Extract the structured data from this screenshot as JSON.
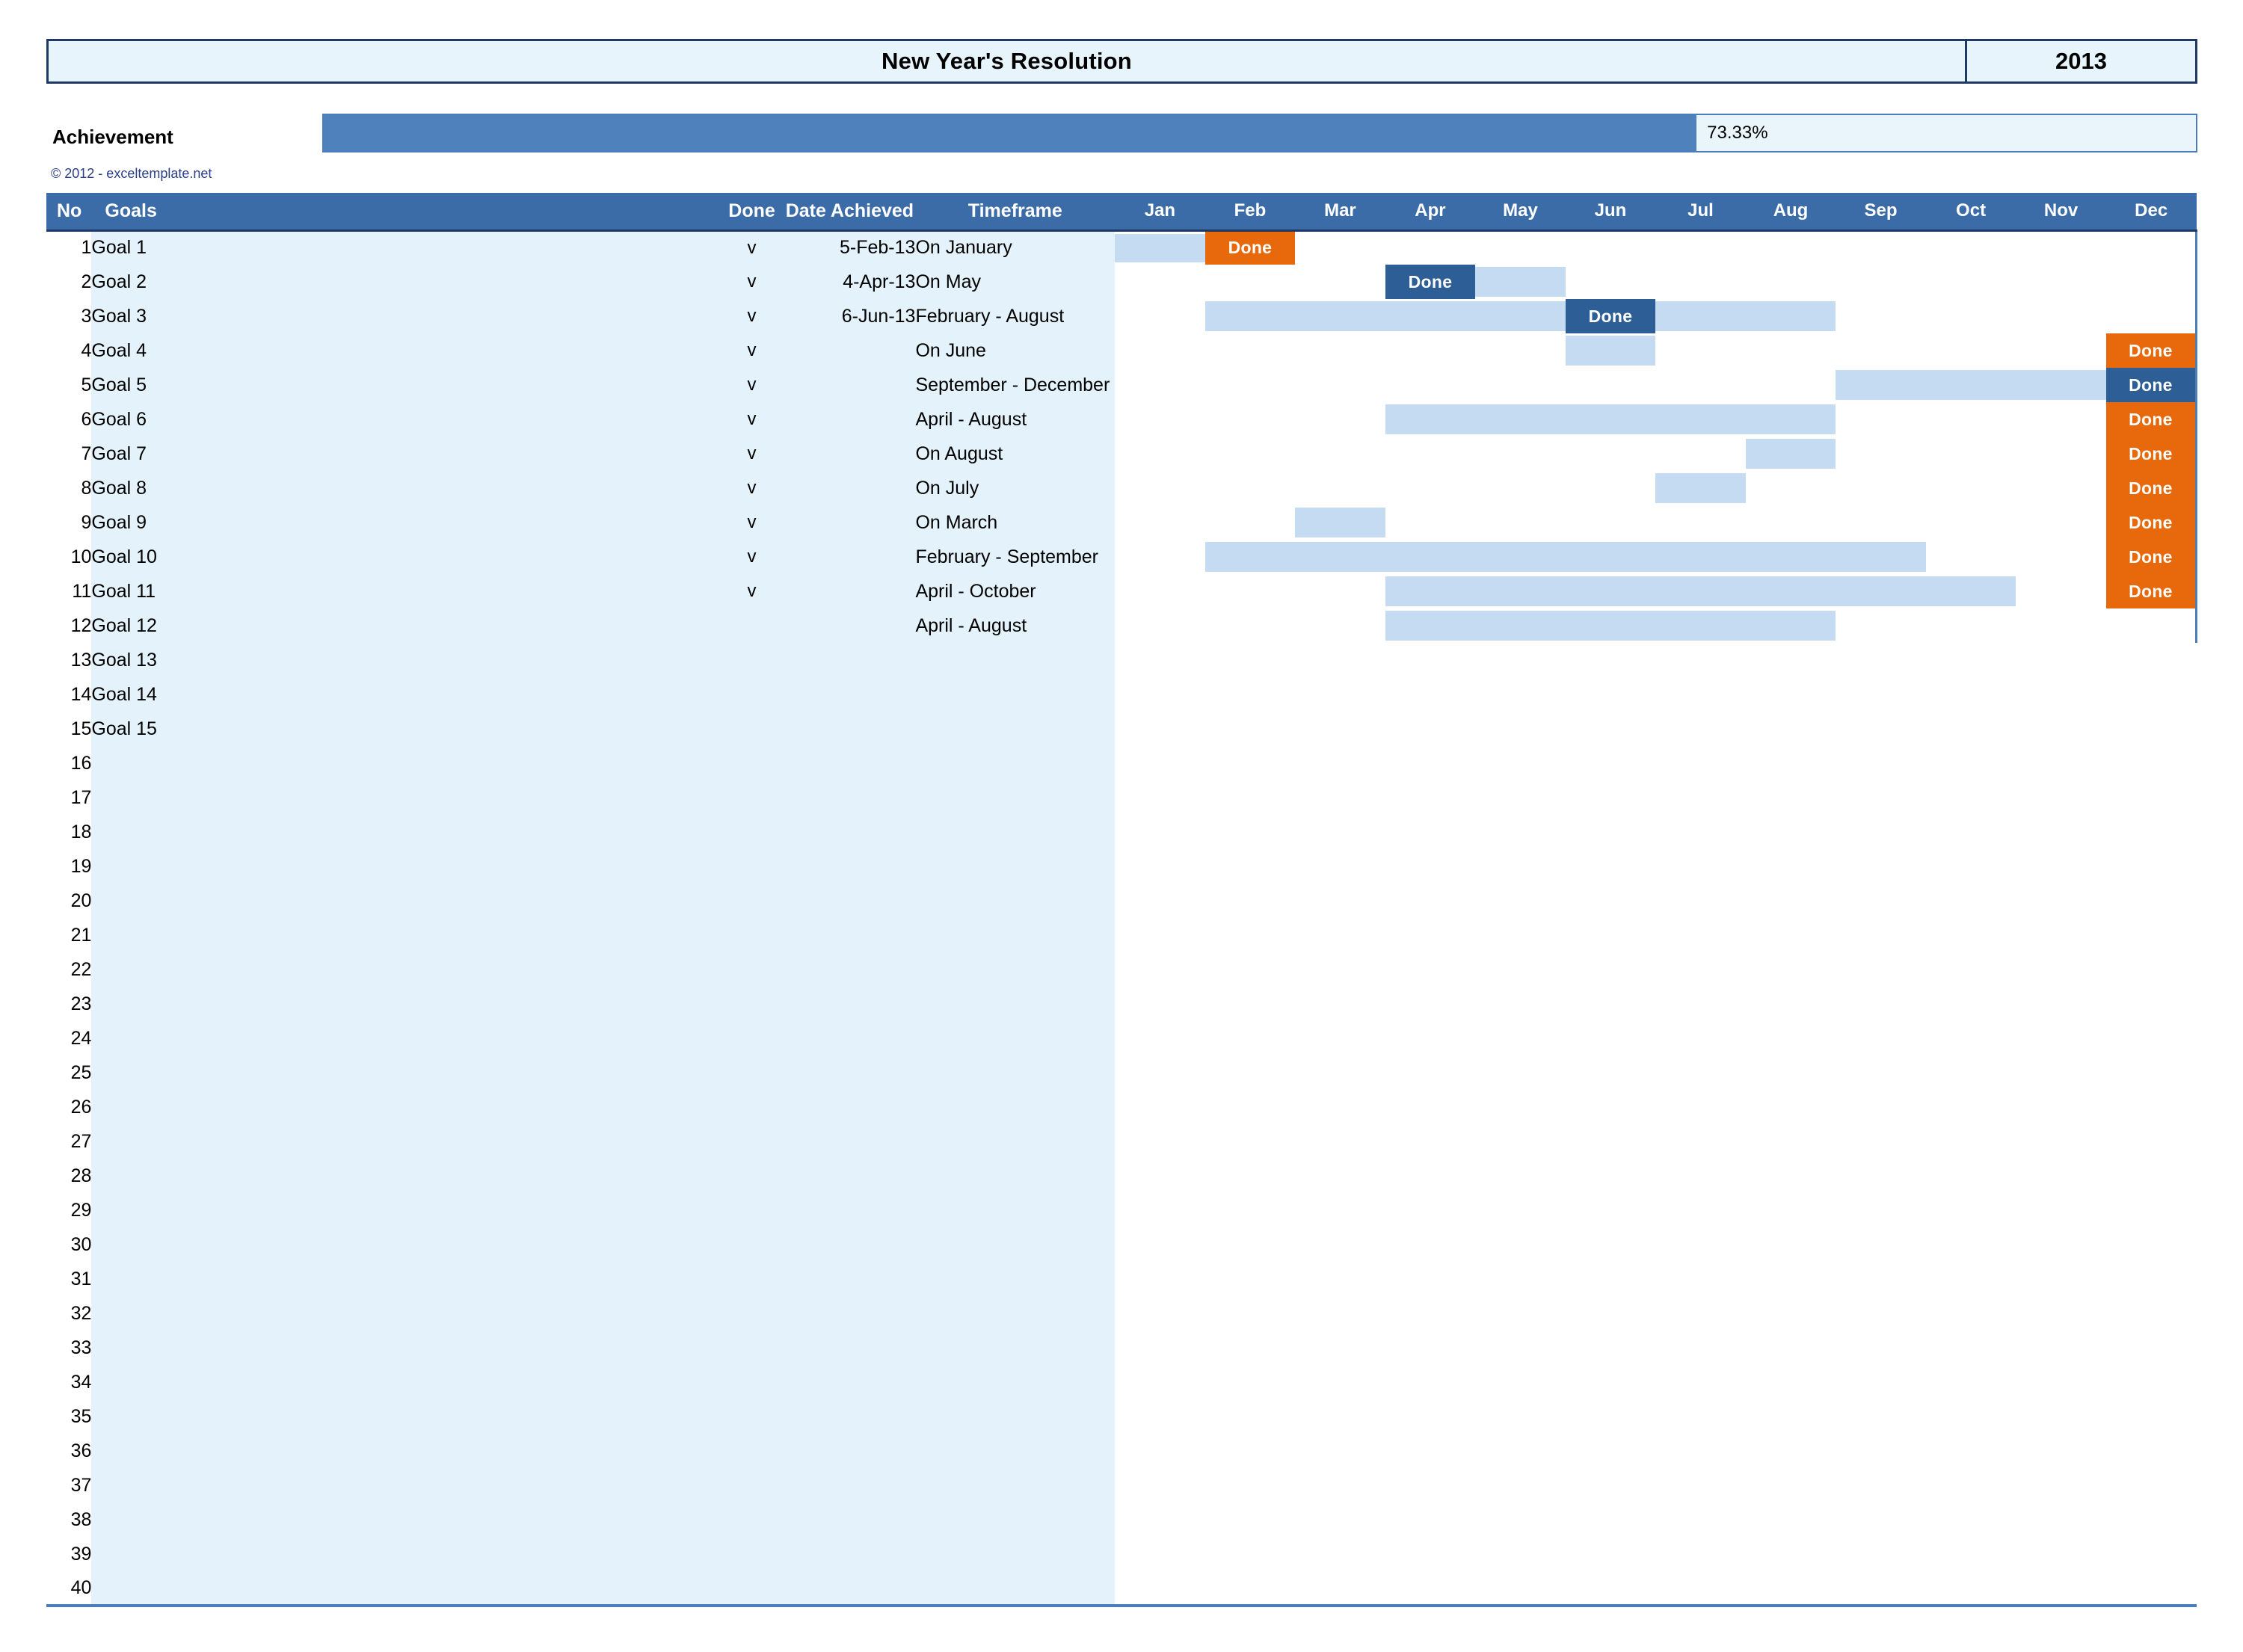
{
  "header": {
    "title": "New Year's Resolution",
    "year": "2013"
  },
  "achievement": {
    "label": "Achievement",
    "percent_text": "73.33%",
    "percent_value": 73.33
  },
  "copyright": "© 2012 - exceltemplate.net",
  "columns": {
    "no": "No",
    "goals": "Goals",
    "done": "Done",
    "date_achieved": "Date Achieved",
    "timeframe": "Timeframe"
  },
  "months": [
    "Jan",
    "Feb",
    "Mar",
    "Apr",
    "May",
    "Jun",
    "Jul",
    "Aug",
    "Sep",
    "Oct",
    "Nov",
    "Dec"
  ],
  "colors": {
    "header_blue": "#3C6CA8",
    "grid_blue": "#4A7EBB",
    "goal_cell_bg": "#E4F3FB",
    "bar_light": "#C5DBF2",
    "done_orange": "#E8690B",
    "done_blue": "#2E5E96",
    "progress_fill": "#4F81BD",
    "title_border": "#1F3864",
    "copyright_text": "#2B3F87"
  },
  "done_label": "Done",
  "check_mark": "v",
  "rows": [
    {
      "no": "1",
      "goal": "Goal 1",
      "done": "v",
      "date": "5-Feb-13",
      "timeframe": "On January",
      "bar_start": 1,
      "bar_end": 1,
      "done_month": 2,
      "done_style": "orange"
    },
    {
      "no": "2",
      "goal": "Goal 2",
      "done": "v",
      "date": "4-Apr-13",
      "timeframe": "On May",
      "bar_start": 5,
      "bar_end": 5,
      "done_month": 4,
      "done_style": "blue"
    },
    {
      "no": "3",
      "goal": "Goal 3",
      "done": "v",
      "date": "6-Jun-13",
      "timeframe": "February - August",
      "bar_start": 2,
      "bar_end": 8,
      "done_month": 6,
      "done_style": "blue"
    },
    {
      "no": "4",
      "goal": "Goal 4",
      "done": "v",
      "date": "",
      "timeframe": "On June",
      "bar_start": 6,
      "bar_end": 6,
      "done_month": 12,
      "done_style": "orange"
    },
    {
      "no": "5",
      "goal": "Goal 5",
      "done": "v",
      "date": "",
      "timeframe": "September - December",
      "bar_start": 9,
      "bar_end": 12,
      "done_month": 12,
      "done_style": "blue"
    },
    {
      "no": "6",
      "goal": "Goal 6",
      "done": "v",
      "date": "",
      "timeframe": "April - August",
      "bar_start": 4,
      "bar_end": 8,
      "done_month": 12,
      "done_style": "orange"
    },
    {
      "no": "7",
      "goal": "Goal 7",
      "done": "v",
      "date": "",
      "timeframe": "On August",
      "bar_start": 8,
      "bar_end": 8,
      "done_month": 12,
      "done_style": "orange"
    },
    {
      "no": "8",
      "goal": "Goal 8",
      "done": "v",
      "date": "",
      "timeframe": "On July",
      "bar_start": 7,
      "bar_end": 7,
      "done_month": 12,
      "done_style": "orange"
    },
    {
      "no": "9",
      "goal": "Goal 9",
      "done": "v",
      "date": "",
      "timeframe": "On March",
      "bar_start": 3,
      "bar_end": 3,
      "done_month": 12,
      "done_style": "orange"
    },
    {
      "no": "10",
      "goal": "Goal 10",
      "done": "v",
      "date": "",
      "timeframe": "February - September",
      "bar_start": 2,
      "bar_end": 9,
      "done_month": 12,
      "done_style": "orange"
    },
    {
      "no": "11",
      "goal": "Goal 11",
      "done": "v",
      "date": "",
      "timeframe": "April - October",
      "bar_start": 4,
      "bar_end": 10,
      "done_month": 12,
      "done_style": "orange"
    },
    {
      "no": "12",
      "goal": "Goal 12",
      "done": "",
      "date": "",
      "timeframe": "April - August",
      "bar_start": 4,
      "bar_end": 8,
      "done_month": 0,
      "done_style": ""
    },
    {
      "no": "13",
      "goal": "Goal 13",
      "done": "",
      "date": "",
      "timeframe": "",
      "bar_start": 0,
      "bar_end": 0,
      "done_month": 0,
      "done_style": ""
    },
    {
      "no": "14",
      "goal": "Goal 14",
      "done": "",
      "date": "",
      "timeframe": "",
      "bar_start": 0,
      "bar_end": 0,
      "done_month": 0,
      "done_style": ""
    },
    {
      "no": "15",
      "goal": "Goal 15",
      "done": "",
      "date": "",
      "timeframe": "",
      "bar_start": 0,
      "bar_end": 0,
      "done_month": 0,
      "done_style": ""
    },
    {
      "no": "16",
      "goal": "",
      "done": "",
      "date": "",
      "timeframe": "",
      "bar_start": 0,
      "bar_end": 0,
      "done_month": 0,
      "done_style": ""
    },
    {
      "no": "17",
      "goal": "",
      "done": "",
      "date": "",
      "timeframe": "",
      "bar_start": 0,
      "bar_end": 0,
      "done_month": 0,
      "done_style": ""
    },
    {
      "no": "18",
      "goal": "",
      "done": "",
      "date": "",
      "timeframe": "",
      "bar_start": 0,
      "bar_end": 0,
      "done_month": 0,
      "done_style": ""
    },
    {
      "no": "19",
      "goal": "",
      "done": "",
      "date": "",
      "timeframe": "",
      "bar_start": 0,
      "bar_end": 0,
      "done_month": 0,
      "done_style": ""
    },
    {
      "no": "20",
      "goal": "",
      "done": "",
      "date": "",
      "timeframe": "",
      "bar_start": 0,
      "bar_end": 0,
      "done_month": 0,
      "done_style": ""
    },
    {
      "no": "21",
      "goal": "",
      "done": "",
      "date": "",
      "timeframe": "",
      "bar_start": 0,
      "bar_end": 0,
      "done_month": 0,
      "done_style": ""
    },
    {
      "no": "22",
      "goal": "",
      "done": "",
      "date": "",
      "timeframe": "",
      "bar_start": 0,
      "bar_end": 0,
      "done_month": 0,
      "done_style": ""
    },
    {
      "no": "23",
      "goal": "",
      "done": "",
      "date": "",
      "timeframe": "",
      "bar_start": 0,
      "bar_end": 0,
      "done_month": 0,
      "done_style": ""
    },
    {
      "no": "24",
      "goal": "",
      "done": "",
      "date": "",
      "timeframe": "",
      "bar_start": 0,
      "bar_end": 0,
      "done_month": 0,
      "done_style": ""
    },
    {
      "no": "25",
      "goal": "",
      "done": "",
      "date": "",
      "timeframe": "",
      "bar_start": 0,
      "bar_end": 0,
      "done_month": 0,
      "done_style": ""
    },
    {
      "no": "26",
      "goal": "",
      "done": "",
      "date": "",
      "timeframe": "",
      "bar_start": 0,
      "bar_end": 0,
      "done_month": 0,
      "done_style": ""
    },
    {
      "no": "27",
      "goal": "",
      "done": "",
      "date": "",
      "timeframe": "",
      "bar_start": 0,
      "bar_end": 0,
      "done_month": 0,
      "done_style": ""
    },
    {
      "no": "28",
      "goal": "",
      "done": "",
      "date": "",
      "timeframe": "",
      "bar_start": 0,
      "bar_end": 0,
      "done_month": 0,
      "done_style": ""
    },
    {
      "no": "29",
      "goal": "",
      "done": "",
      "date": "",
      "timeframe": "",
      "bar_start": 0,
      "bar_end": 0,
      "done_month": 0,
      "done_style": ""
    },
    {
      "no": "30",
      "goal": "",
      "done": "",
      "date": "",
      "timeframe": "",
      "bar_start": 0,
      "bar_end": 0,
      "done_month": 0,
      "done_style": ""
    },
    {
      "no": "31",
      "goal": "",
      "done": "",
      "date": "",
      "timeframe": "",
      "bar_start": 0,
      "bar_end": 0,
      "done_month": 0,
      "done_style": ""
    },
    {
      "no": "32",
      "goal": "",
      "done": "",
      "date": "",
      "timeframe": "",
      "bar_start": 0,
      "bar_end": 0,
      "done_month": 0,
      "done_style": ""
    },
    {
      "no": "33",
      "goal": "",
      "done": "",
      "date": "",
      "timeframe": "",
      "bar_start": 0,
      "bar_end": 0,
      "done_month": 0,
      "done_style": ""
    },
    {
      "no": "34",
      "goal": "",
      "done": "",
      "date": "",
      "timeframe": "",
      "bar_start": 0,
      "bar_end": 0,
      "done_month": 0,
      "done_style": ""
    },
    {
      "no": "35",
      "goal": "",
      "done": "",
      "date": "",
      "timeframe": "",
      "bar_start": 0,
      "bar_end": 0,
      "done_month": 0,
      "done_style": ""
    },
    {
      "no": "36",
      "goal": "",
      "done": "",
      "date": "",
      "timeframe": "",
      "bar_start": 0,
      "bar_end": 0,
      "done_month": 0,
      "done_style": ""
    },
    {
      "no": "37",
      "goal": "",
      "done": "",
      "date": "",
      "timeframe": "",
      "bar_start": 0,
      "bar_end": 0,
      "done_month": 0,
      "done_style": ""
    },
    {
      "no": "38",
      "goal": "",
      "done": "",
      "date": "",
      "timeframe": "",
      "bar_start": 0,
      "bar_end": 0,
      "done_month": 0,
      "done_style": ""
    },
    {
      "no": "39",
      "goal": "",
      "done": "",
      "date": "",
      "timeframe": "",
      "bar_start": 0,
      "bar_end": 0,
      "done_month": 0,
      "done_style": ""
    },
    {
      "no": "40",
      "goal": "",
      "done": "",
      "date": "",
      "timeframe": "",
      "bar_start": 0,
      "bar_end": 0,
      "done_month": 0,
      "done_style": ""
    }
  ]
}
